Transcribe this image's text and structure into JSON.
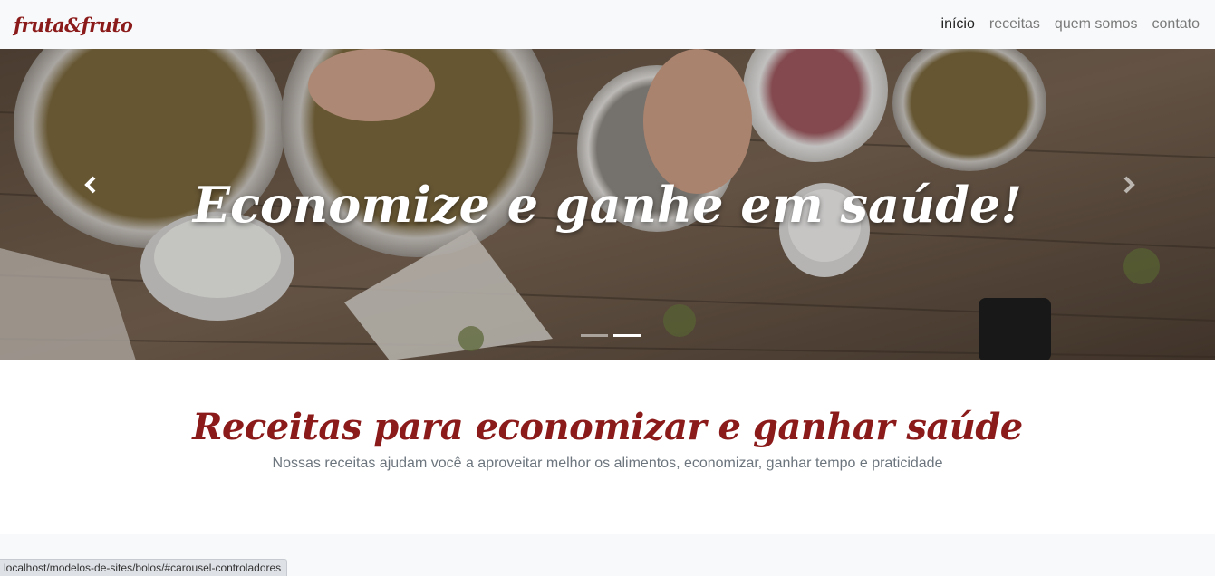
{
  "navbar": {
    "brand": "fruta&fruto",
    "items": [
      {
        "label": "início",
        "active": true
      },
      {
        "label": "receitas",
        "active": false
      },
      {
        "label": "quem somos",
        "active": false
      },
      {
        "label": "contato",
        "active": false
      }
    ]
  },
  "carousel": {
    "caption": "Economize e ganhe em saúde!",
    "prev_icon": "chevron-left-icon",
    "next_icon": "chevron-right-icon",
    "slides_count": 2,
    "active_slide": 2
  },
  "intro": {
    "title": "Receitas para economizar e ganhar saúde",
    "subtitle": "Nossas receitas ajudam você a aproveitar melhor os alimentos, economizar, ganhar tempo e praticidade"
  },
  "status_bar": {
    "url": "localhost/modelos-de-sites/bolos/#carousel-controladores"
  },
  "colors": {
    "brand": "#8b1a1a",
    "navbar_bg": "#f8f9fa",
    "muted_text": "#6c757d"
  }
}
